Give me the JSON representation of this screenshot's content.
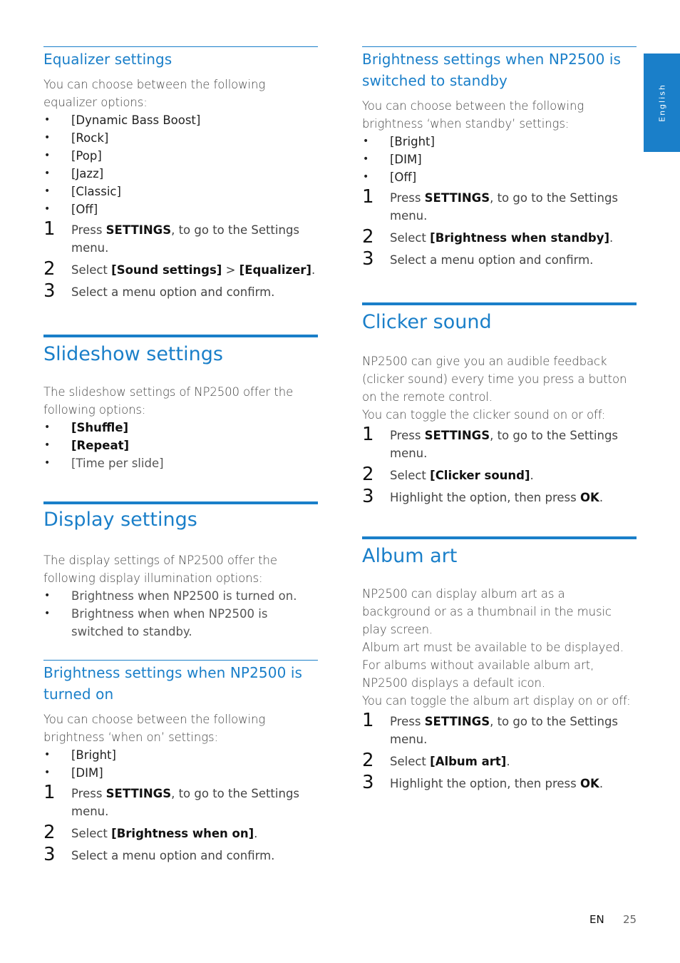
{
  "side_tab": {
    "label": "English"
  },
  "footer": {
    "lang": "EN",
    "page": "25"
  },
  "left": {
    "equalizer": {
      "title": "Equalizer settings",
      "intro": "You can choose between the following equalizer options:",
      "options": [
        "[Dynamic Bass Boost]",
        "[Rock]",
        "[Pop]",
        "[Jazz]",
        "[Classic]",
        "[Off]"
      ],
      "steps": [
        {
          "num": "1",
          "pre": "Press ",
          "em": "SETTINGS",
          "post": ", to go to the Settings menu."
        },
        {
          "num": "2",
          "pre": "Select ",
          "em": "[Sound settings]",
          "mid": " > ",
          "em2": "[Equalizer]",
          "post": "."
        },
        {
          "num": "3",
          "pre": "Select a menu option and confirm.",
          "em": "",
          "post": ""
        }
      ]
    },
    "slideshow": {
      "title": "Slideshow settings",
      "intro": "The slideshow settings of NP2500 offer the following options:",
      "options": [
        "[Shuffle]",
        "[Repeat]",
        "[Time per slide]"
      ]
    },
    "display": {
      "title": "Display settings",
      "intro": "The display settings of NP2500 offer the following display illumination options:",
      "options": [
        "Brightness when NP2500 is turned on.",
        "Brightness when when NP2500 is switched to standby."
      ]
    },
    "brightness_on": {
      "title": "Brightness settings when NP2500 is turned on",
      "intro": "You can choose between the following brightness ‘when on’ settings:",
      "options": [
        "[Bright]",
        "[DIM]"
      ],
      "steps": [
        {
          "num": "1",
          "pre": "Press ",
          "em": "SETTINGS",
          "post": ", to go to the Settings menu."
        },
        {
          "num": "2",
          "pre": "Select ",
          "em": "[Brightness when on]",
          "post": "."
        },
        {
          "num": "3",
          "pre": "Select a menu option and confirm.",
          "em": "",
          "post": ""
        }
      ]
    }
  },
  "right": {
    "brightness_standby": {
      "title": "Brightness settings when NP2500 is switched to standby",
      "intro": "You can choose between the following brightness ‘when standby’ settings:",
      "options": [
        "[Bright]",
        "[DIM]",
        "[Off]"
      ],
      "steps": [
        {
          "num": "1",
          "pre": "Press ",
          "em": "SETTINGS",
          "post": ", to go to the Settings menu."
        },
        {
          "num": "2",
          "pre": "Select ",
          "em": "[Brightness when standby]",
          "post": "."
        },
        {
          "num": "3",
          "pre": "Select a menu option and confirm.",
          "em": "",
          "post": ""
        }
      ]
    },
    "clicker": {
      "title": "Clicker sound",
      "intro": "NP2500 can give you an audible feedback (clicker sound) every time you press a button on the remote control.",
      "intro2": "You can toggle the clicker sound on or off:",
      "steps": [
        {
          "num": "1",
          "pre": "Press ",
          "em": "SETTINGS",
          "post": ", to go to the Settings menu."
        },
        {
          "num": "2",
          "pre": "Select ",
          "em": "[Clicker sound]",
          "post": "."
        },
        {
          "num": "3",
          "pre": "Highlight the option, then press ",
          "em": "OK",
          "post": "."
        }
      ]
    },
    "album": {
      "title": "Album art",
      "intro": "NP2500 can display album art as a background or as a thumbnail in the music play screen.",
      "intro2": "Album art must be available to be displayed.",
      "intro3": "For albums without available album art, NP2500 displays a default icon.",
      "intro4": "You can toggle the album art display on or off:",
      "steps": [
        {
          "num": "1",
          "pre": "Press ",
          "em": "SETTINGS",
          "post": ", to go to the Settings menu."
        },
        {
          "num": "2",
          "pre": "Select ",
          "em": "[Album art]",
          "post": "."
        },
        {
          "num": "3",
          "pre": "Highlight the option, then press ",
          "em": "OK",
          "post": "."
        }
      ]
    }
  }
}
